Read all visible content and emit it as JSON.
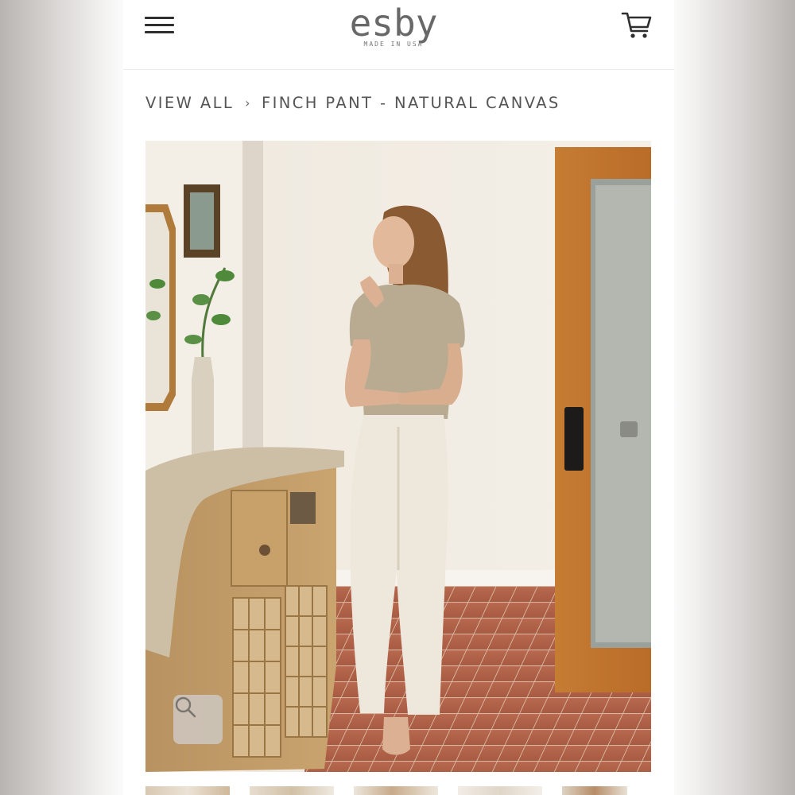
{
  "header": {
    "menu_icon": "hamburger-menu-icon",
    "logo": {
      "word": "esby",
      "tagline": "MADE IN USA"
    },
    "cart_icon": "shopping-cart-icon"
  },
  "breadcrumb": {
    "parent": "VIEW ALL",
    "separator": "›",
    "current": "FINCH PANT - NATURAL CANVAS"
  },
  "product_image": {
    "zoom_icon": "magnifier-icon"
  },
  "thumbnails": {
    "count_visible": 5
  },
  "colors": {
    "text": "#555555",
    "icon": "#2f2f2f",
    "logo": "#686868"
  }
}
